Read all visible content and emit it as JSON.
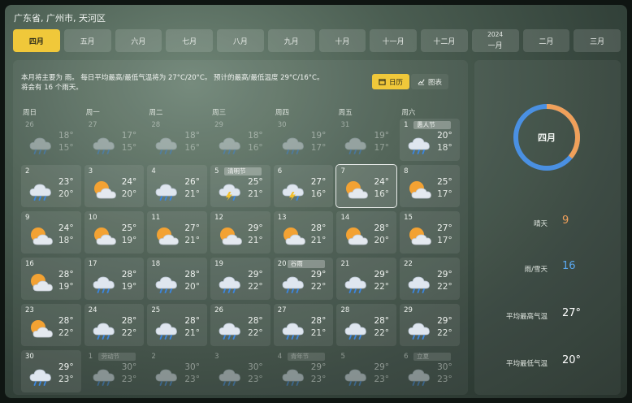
{
  "location": "广东省, 广州市, 天河区",
  "months": [
    {
      "label": "四月",
      "active": true
    },
    {
      "label": "五月"
    },
    {
      "label": "六月"
    },
    {
      "label": "七月"
    },
    {
      "label": "八月"
    },
    {
      "label": "九月"
    },
    {
      "label": "十月"
    },
    {
      "label": "十一月"
    },
    {
      "label": "十二月"
    },
    {
      "label": "一月",
      "year": "2024"
    },
    {
      "label": "二月"
    },
    {
      "label": "三月"
    }
  ],
  "summary": {
    "text": "本月将主要为 雨。 每日平均最高/最低气温将为 27°C/20°C。 预计的最高/最低温度 29°C/16°C。 将会有 16 个雨天。"
  },
  "view_toggle": {
    "calendar_label": "日历",
    "chart_label": "图表",
    "active": "calendar"
  },
  "weekdays": [
    "周日",
    "周一",
    "周二",
    "周三",
    "周四",
    "周五",
    "周六"
  ],
  "days": [
    {
      "day": "26",
      "hi": "18°",
      "lo": "15°",
      "icon": "cloud-rain-icon",
      "dim": true
    },
    {
      "day": "27",
      "hi": "17°",
      "lo": "15°",
      "icon": "cloud-rain-icon",
      "dim": true
    },
    {
      "day": "28",
      "hi": "18°",
      "lo": "16°",
      "icon": "cloud-rain-icon",
      "dim": true
    },
    {
      "day": "29",
      "hi": "18°",
      "lo": "16°",
      "icon": "cloud-rain-icon",
      "dim": true
    },
    {
      "day": "30",
      "hi": "19°",
      "lo": "17°",
      "icon": "cloud-rain-icon",
      "dim": true
    },
    {
      "day": "31",
      "hi": "19°",
      "lo": "17°",
      "icon": "cloud-rain-icon",
      "dim": true
    },
    {
      "day": "1",
      "hi": "20°",
      "lo": "18°",
      "icon": "cloud-rain-icon",
      "festival": "愚人节"
    },
    {
      "day": "2",
      "hi": "23°",
      "lo": "20°",
      "icon": "cloud-rain-icon"
    },
    {
      "day": "3",
      "hi": "24°",
      "lo": "20°",
      "icon": "sun-cloud-icon"
    },
    {
      "day": "4",
      "hi": "26°",
      "lo": "21°",
      "icon": "cloud-rain-icon"
    },
    {
      "day": "5",
      "hi": "25°",
      "lo": "21°",
      "icon": "thunderstorm-icon",
      "festival": "清明节"
    },
    {
      "day": "6",
      "hi": "27°",
      "lo": "16°",
      "icon": "thunderstorm-icon"
    },
    {
      "day": "7",
      "hi": "24°",
      "lo": "16°",
      "icon": "sun-cloud-icon",
      "today": true
    },
    {
      "day": "8",
      "hi": "25°",
      "lo": "17°",
      "icon": "sun-cloud-icon"
    },
    {
      "day": "9",
      "hi": "24°",
      "lo": "18°",
      "icon": "sun-cloud-icon"
    },
    {
      "day": "10",
      "hi": "25°",
      "lo": "19°",
      "icon": "sun-cloud-icon"
    },
    {
      "day": "11",
      "hi": "27°",
      "lo": "21°",
      "icon": "sun-cloud-icon"
    },
    {
      "day": "12",
      "hi": "29°",
      "lo": "21°",
      "icon": "sun-cloud-icon"
    },
    {
      "day": "13",
      "hi": "28°",
      "lo": "21°",
      "icon": "sun-cloud-icon"
    },
    {
      "day": "14",
      "hi": "28°",
      "lo": "20°",
      "icon": "sun-cloud-icon"
    },
    {
      "day": "15",
      "hi": "27°",
      "lo": "17°",
      "icon": "sun-cloud-icon"
    },
    {
      "day": "16",
      "hi": "28°",
      "lo": "19°",
      "icon": "sun-cloud-icon"
    },
    {
      "day": "17",
      "hi": "28°",
      "lo": "19°",
      "icon": "cloud-rain-icon"
    },
    {
      "day": "18",
      "hi": "28°",
      "lo": "20°",
      "icon": "cloud-rain-icon"
    },
    {
      "day": "19",
      "hi": "29°",
      "lo": "22°",
      "icon": "cloud-rain-icon"
    },
    {
      "day": "20",
      "hi": "29°",
      "lo": "22°",
      "icon": "cloud-rain-icon",
      "festival": "谷雨"
    },
    {
      "day": "21",
      "hi": "29°",
      "lo": "22°",
      "icon": "cloud-rain-icon"
    },
    {
      "day": "22",
      "hi": "29°",
      "lo": "22°",
      "icon": "cloud-rain-icon"
    },
    {
      "day": "23",
      "hi": "28°",
      "lo": "22°",
      "icon": "sun-cloud-icon"
    },
    {
      "day": "24",
      "hi": "28°",
      "lo": "22°",
      "icon": "cloud-rain-icon"
    },
    {
      "day": "25",
      "hi": "28°",
      "lo": "21°",
      "icon": "cloud-rain-icon"
    },
    {
      "day": "26",
      "hi": "28°",
      "lo": "22°",
      "icon": "cloud-rain-icon"
    },
    {
      "day": "27",
      "hi": "28°",
      "lo": "21°",
      "icon": "cloud-rain-icon"
    },
    {
      "day": "28",
      "hi": "28°",
      "lo": "22°",
      "icon": "cloud-rain-icon"
    },
    {
      "day": "29",
      "hi": "29°",
      "lo": "22°",
      "icon": "cloud-rain-icon"
    },
    {
      "day": "30",
      "hi": "29°",
      "lo": "23°",
      "icon": "cloud-rain-icon"
    },
    {
      "day": "1",
      "hi": "30°",
      "lo": "23°",
      "icon": "cloud-rain-icon",
      "dim": true,
      "festival": "劳动节"
    },
    {
      "day": "2",
      "hi": "30°",
      "lo": "23°",
      "icon": "cloud-rain-icon",
      "dim": true
    },
    {
      "day": "3",
      "hi": "30°",
      "lo": "23°",
      "icon": "cloud-rain-icon",
      "dim": true
    },
    {
      "day": "4",
      "hi": "29°",
      "lo": "23°",
      "icon": "cloud-rain-icon",
      "dim": true,
      "festival": "青年节"
    },
    {
      "day": "5",
      "hi": "29°",
      "lo": "23°",
      "icon": "cloud-rain-icon",
      "dim": true
    },
    {
      "day": "6",
      "hi": "30°",
      "lo": "23°",
      "icon": "cloud-rain-icon",
      "dim": true,
      "festival": "立夏"
    }
  ],
  "side": {
    "ring_label": "四月",
    "sunny_fraction": 0.36,
    "stats": [
      {
        "key": "晴天",
        "value": "9",
        "color": "#f0a05a"
      },
      {
        "key": "雨/雪天",
        "value": "16",
        "color": "#5aa8f0"
      },
      {
        "key": "平均最高气温",
        "value": "27°",
        "color": "#ffffff"
      },
      {
        "key": "平均最低气温",
        "value": "20°",
        "color": "#ffffff"
      }
    ]
  },
  "colors": {
    "accent": "#f0c83a",
    "sunny": "#f0a05a",
    "rain": "#4a90e2"
  }
}
